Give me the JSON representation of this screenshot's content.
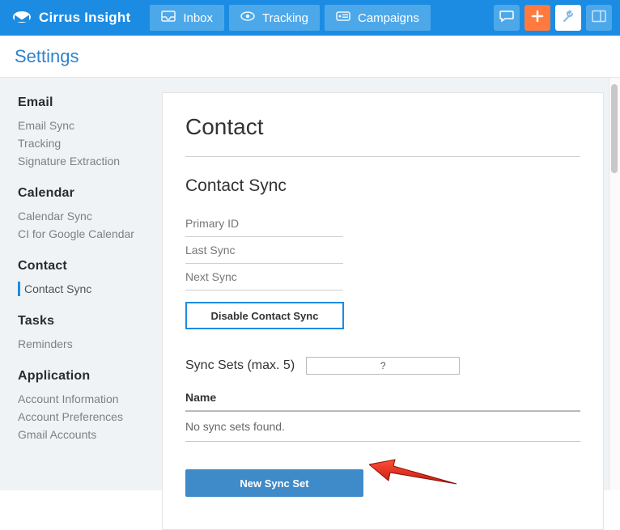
{
  "brand": {
    "name": "Cirrus Insight"
  },
  "nav": {
    "items": [
      {
        "label": "Inbox"
      },
      {
        "label": "Tracking"
      },
      {
        "label": "Campaigns"
      }
    ]
  },
  "pagebar": {
    "title": "Settings"
  },
  "sidebar": {
    "groups": [
      {
        "head": "Email",
        "items": [
          "Email Sync",
          "Tracking",
          "Signature Extraction"
        ]
      },
      {
        "head": "Calendar",
        "items": [
          "Calendar Sync",
          "CI for Google Calendar"
        ]
      },
      {
        "head": "Contact",
        "items": [
          "Contact Sync"
        ],
        "active_index": 0
      },
      {
        "head": "Tasks",
        "items": [
          "Reminders"
        ]
      },
      {
        "head": "Application",
        "items": [
          "Account Information",
          "Account Preferences",
          "Gmail Accounts"
        ]
      }
    ]
  },
  "main": {
    "title": "Contact",
    "section": "Contact Sync",
    "rows": [
      "Primary ID",
      "Last Sync",
      "Next Sync"
    ],
    "disable_btn": "Disable Contact Sync",
    "syncsets_label": "Sync Sets (max. 5)",
    "syncsets_hint": "?",
    "table_head": "Name",
    "table_empty": "No sync sets found.",
    "new_btn": "New Sync Set"
  }
}
